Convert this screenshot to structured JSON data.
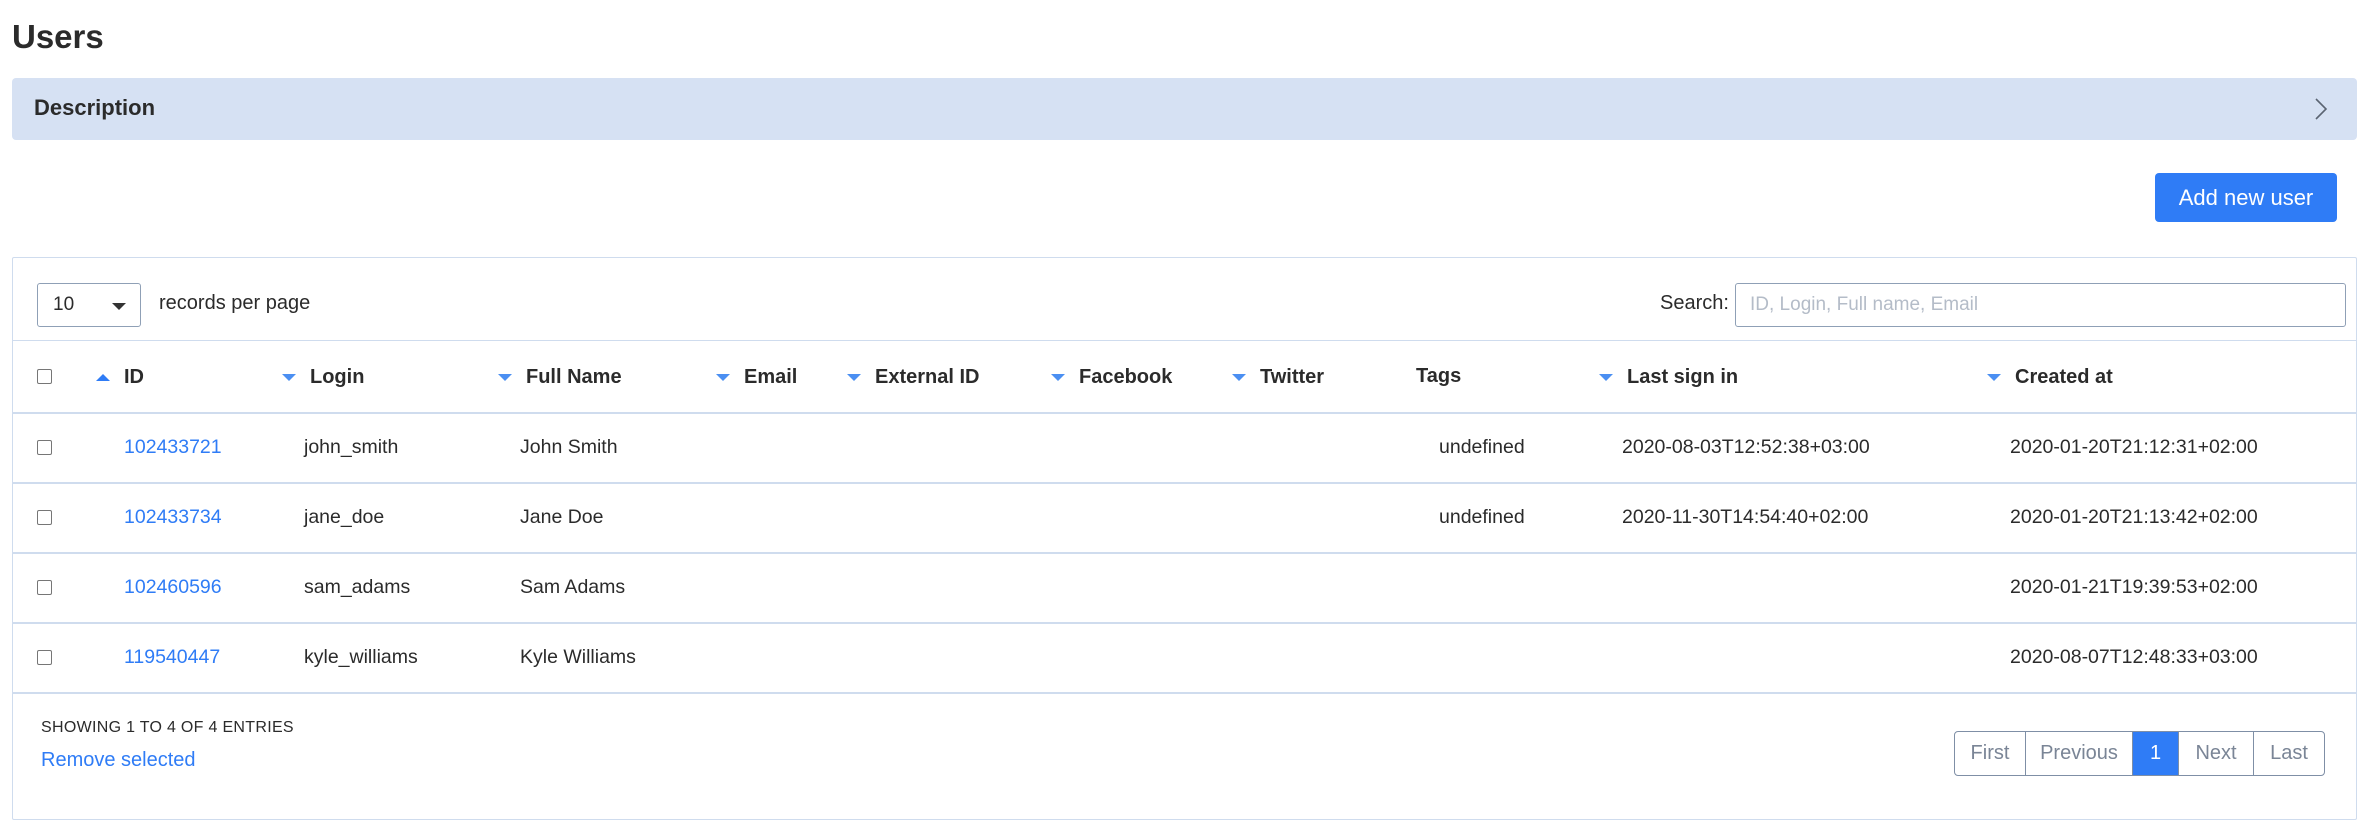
{
  "page": {
    "title": "Users"
  },
  "description": {
    "label": "Description",
    "icon": "chevron-right-icon"
  },
  "actions": {
    "add_user": "Add new user"
  },
  "length": {
    "value": "10",
    "label": "records per page"
  },
  "search": {
    "label": "Search:",
    "placeholder": "ID, Login, Full name, Email"
  },
  "table": {
    "columns": [
      "ID",
      "Login",
      "Full Name",
      "Email",
      "External ID",
      "Facebook",
      "Twitter",
      "Tags",
      "Last sign in",
      "Created at"
    ],
    "rows": [
      {
        "id": "102433721",
        "login": "john_smith",
        "full_name": "John Smith",
        "email": "",
        "external_id": "",
        "facebook": "",
        "twitter": "",
        "tags": "undefined",
        "last_sign_in": "2020-08-03T12:52:38+03:00",
        "created_at": "2020-01-20T21:12:31+02:00"
      },
      {
        "id": "102433734",
        "login": "jane_doe",
        "full_name": "Jane Doe",
        "email": "",
        "external_id": "",
        "facebook": "",
        "twitter": "",
        "tags": "undefined",
        "last_sign_in": "2020-11-30T14:54:40+02:00",
        "created_at": "2020-01-20T21:13:42+02:00"
      },
      {
        "id": "102460596",
        "login": "sam_adams",
        "full_name": "Sam Adams",
        "email": "",
        "external_id": "",
        "facebook": "",
        "twitter": "",
        "tags": "",
        "last_sign_in": "",
        "created_at": "2020-01-21T19:39:53+02:00"
      },
      {
        "id": "119540447",
        "login": "kyle_williams",
        "full_name": "Kyle Williams",
        "email": "",
        "external_id": "",
        "facebook": "",
        "twitter": "",
        "tags": "",
        "last_sign_in": "",
        "created_at": "2020-08-07T12:48:33+03:00"
      }
    ]
  },
  "footer": {
    "info": "SHOWING 1 TO 4 OF 4 ENTRIES",
    "remove_selected": "Remove selected"
  },
  "pagination": {
    "first": "First",
    "previous": "Previous",
    "current": "1",
    "next": "Next",
    "last": "Last"
  },
  "colors": {
    "accent": "#2f7cf6",
    "description_bg": "#d6e1f3",
    "border": "#cfdcee"
  }
}
